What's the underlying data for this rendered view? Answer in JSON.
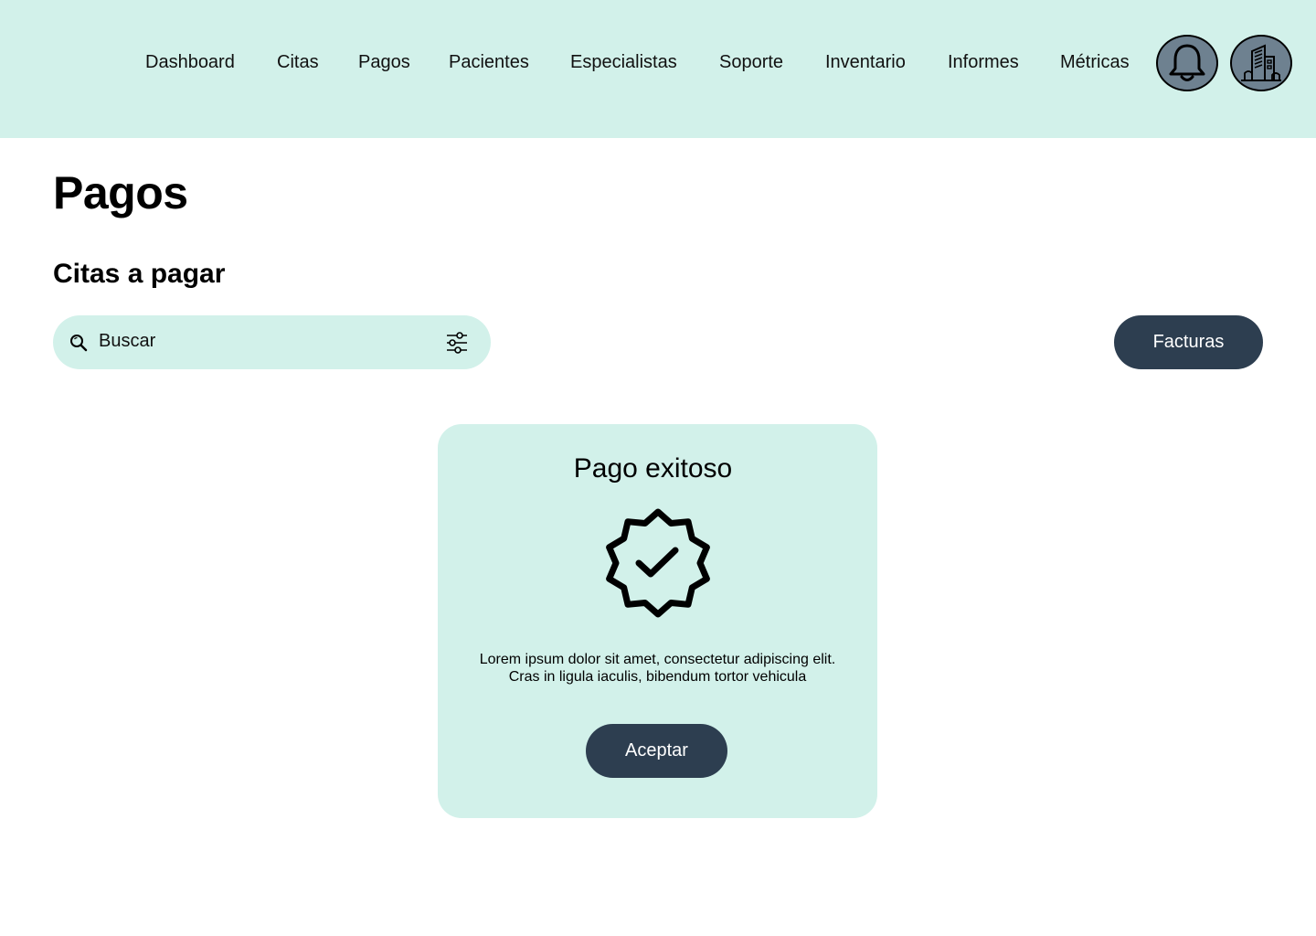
{
  "nav": {
    "items": [
      {
        "label": "Dashboard"
      },
      {
        "label": "Citas"
      },
      {
        "label": "Pagos"
      },
      {
        "label": "Pacientes"
      },
      {
        "label": "Especialistas"
      },
      {
        "label": "Soporte"
      },
      {
        "label": "Inventario"
      },
      {
        "label": "Informes"
      },
      {
        "label": "Métricas"
      }
    ],
    "icons": [
      "bell-icon",
      "building-icon"
    ]
  },
  "page": {
    "title": "Pagos",
    "section_title": "Citas a pagar"
  },
  "search": {
    "placeholder": "Buscar"
  },
  "toolbar": {
    "facturas_label": "Facturas"
  },
  "modal": {
    "title": "Pago exitoso",
    "text_line1": "Lorem ipsum dolor sit amet, consectetur adipiscing elit.",
    "text_line2": "Cras in ligula iaculis, bibendum tortor vehicula",
    "accept_label": "Aceptar"
  },
  "colors": {
    "header_bg": "#d2f1ea",
    "surface_mint": "#d2f1ea",
    "button_dark": "#2d3e50",
    "icon_circle": "#6e8190"
  }
}
